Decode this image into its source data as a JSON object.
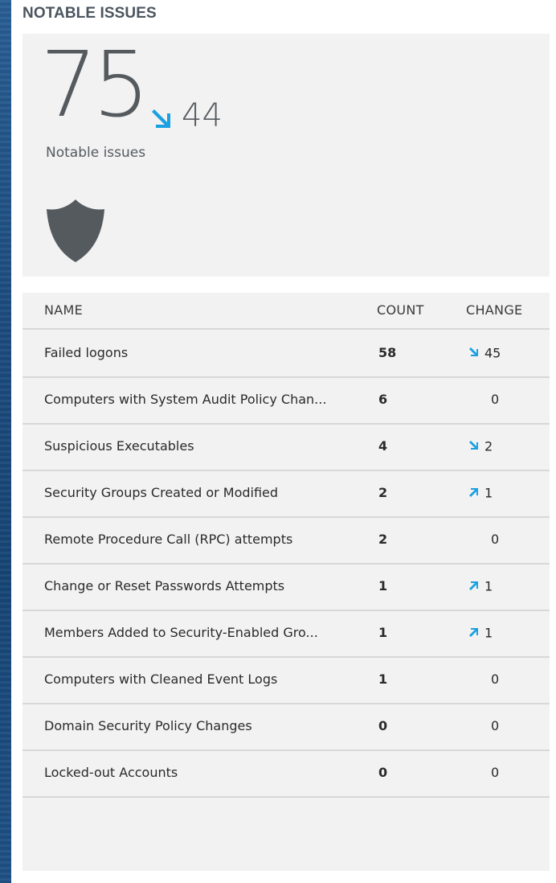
{
  "section": {
    "title": "NOTABLE ISSUES"
  },
  "summary": {
    "value": "75",
    "trend": "down",
    "trend_value": "44",
    "label": "Notable issues",
    "icon": "shield-icon"
  },
  "colors": {
    "accent": "#1ba1e2",
    "card_bg": "#f2f2f2",
    "text": "#555a5f"
  },
  "table": {
    "headers": {
      "name": "NAME",
      "count": "COUNT",
      "change": "CHANGE"
    },
    "rows": [
      {
        "name": "Failed logons",
        "count": "58",
        "change": "45",
        "trend": "down"
      },
      {
        "name": "Computers with System Audit Policy Chan...",
        "count": "6",
        "change": "0",
        "trend": "none"
      },
      {
        "name": "Suspicious Executables",
        "count": "4",
        "change": "2",
        "trend": "down"
      },
      {
        "name": "Security Groups Created or Modified",
        "count": "2",
        "change": "1",
        "trend": "up"
      },
      {
        "name": "Remote Procedure Call (RPC) attempts",
        "count": "2",
        "change": "0",
        "trend": "none"
      },
      {
        "name": "Change or Reset Passwords Attempts",
        "count": "1",
        "change": "1",
        "trend": "up"
      },
      {
        "name": "Members Added to Security-Enabled Gro...",
        "count": "1",
        "change": "1",
        "trend": "up"
      },
      {
        "name": "Computers with Cleaned Event Logs",
        "count": "1",
        "change": "0",
        "trend": "none"
      },
      {
        "name": "Domain Security Policy Changes",
        "count": "0",
        "change": "0",
        "trend": "none"
      },
      {
        "name": "Locked-out Accounts",
        "count": "0",
        "change": "0",
        "trend": "none"
      }
    ]
  }
}
